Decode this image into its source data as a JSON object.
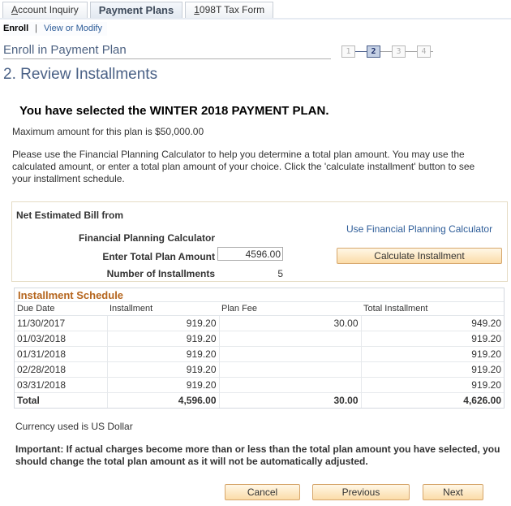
{
  "tabs": [
    {
      "prefix": "",
      "underline": "A",
      "rest": "ccount Inquiry",
      "active": false
    },
    {
      "prefix": "",
      "underline": "",
      "rest": "Payment Plans",
      "active": true
    },
    {
      "prefix": "",
      "underline": "1",
      "rest": "098T Tax Form",
      "active": false
    }
  ],
  "subnav": {
    "current": "Enroll",
    "separator": "|",
    "link": "View or Modify"
  },
  "header": {
    "subtitle": "Enroll in Payment Plan",
    "title": "2. Review Installments"
  },
  "steps": {
    "items": [
      "1",
      "2",
      "3",
      "4"
    ],
    "current": 2
  },
  "plan": {
    "selected_text": "You have selected the WINTER 2018 PAYMENT PLAN.",
    "max_text": "Maximum amount for this plan is $50,000.00",
    "instructions": "Please use the Financial Planning Calculator to help you determine a total plan amount. You may use the calculated amount, or enter a total plan amount of your choice. Click the 'calculate installment' button to see your installment schedule."
  },
  "calculator": {
    "net_label": "Net Estimated Bill from",
    "fpc_label": "Financial Planning Calculator",
    "amount_label": "Enter Total Plan Amount",
    "amount_value": "4596.00",
    "num_label": "Number of Installments",
    "num_value": "5",
    "fpc_link": "Use Financial Planning Calculator",
    "calc_button": "Calculate Installment"
  },
  "schedule": {
    "title": "Installment Schedule",
    "columns": [
      "Due Date",
      "Installment",
      "Plan Fee",
      "Total Installment"
    ],
    "rows": [
      [
        "11/30/2017",
        "919.20",
        "30.00",
        "949.20"
      ],
      [
        "01/03/2018",
        "919.20",
        "",
        "919.20"
      ],
      [
        "01/31/2018",
        "919.20",
        "",
        "919.20"
      ],
      [
        "02/28/2018",
        "919.20",
        "",
        "919.20"
      ],
      [
        "03/31/2018",
        "919.20",
        "",
        "919.20"
      ]
    ],
    "total": [
      "Total",
      "4,596.00",
      "30.00",
      "4,626.00"
    ]
  },
  "footer": {
    "currency": "Currency used is US Dollar",
    "important": "Important: If actual charges become more than or less than the total plan amount you have selected, you should change the total plan amount as it will not be automatically adjusted.",
    "cancel": "Cancel",
    "previous": "Previous",
    "next": "Next"
  },
  "colors": {
    "accent_link": "#2d5c98",
    "title_blue": "#4a6186",
    "schedule_title": "#b5651d",
    "button_border": "#d6a66b"
  }
}
